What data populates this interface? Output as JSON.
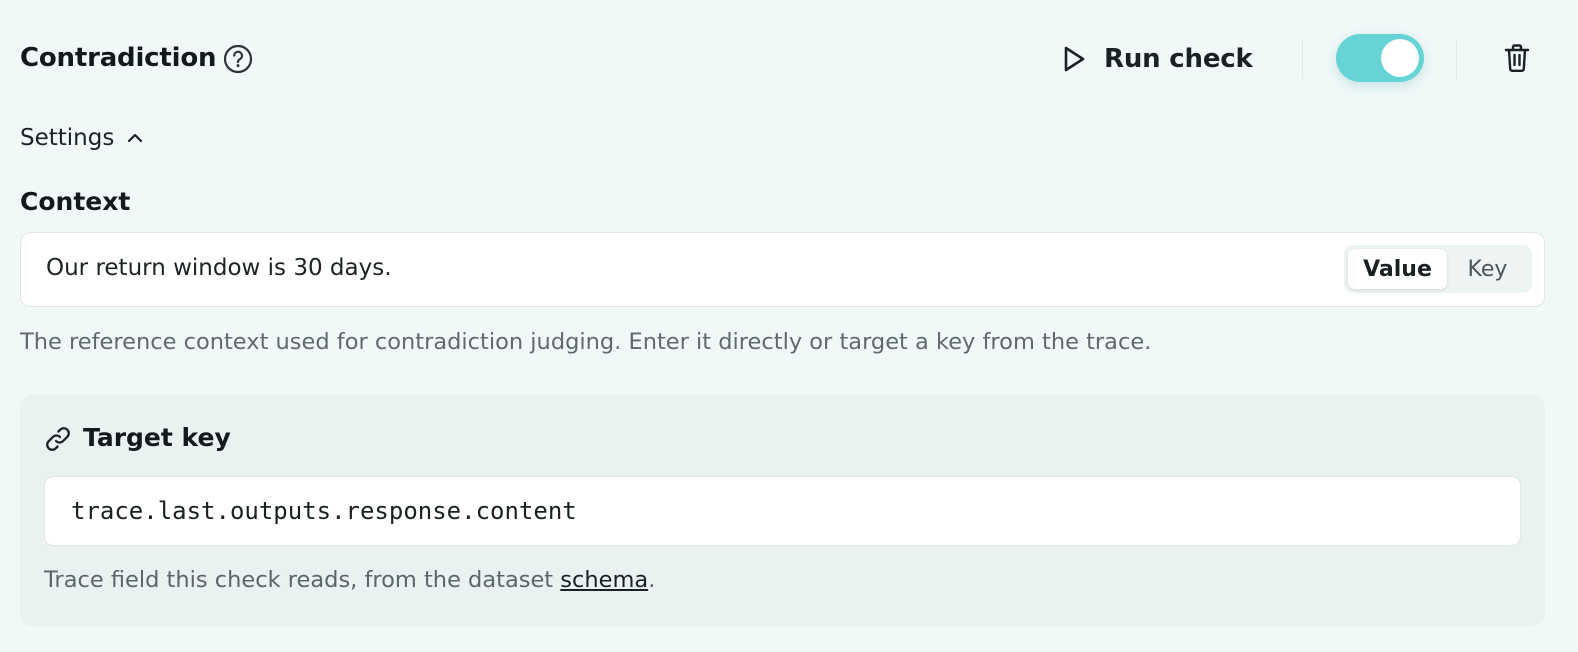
{
  "header": {
    "title": "Contradiction",
    "help_icon": "question-circle-icon",
    "run_label": "Run check",
    "run_icon": "play-icon",
    "toggle": {
      "state": "on",
      "color": "#66d4d6"
    },
    "delete_icon": "trash-icon"
  },
  "settings": {
    "label": "Settings",
    "icon": "chevron-up-icon"
  },
  "context": {
    "label": "Context",
    "value": "Our return window is 30 days.",
    "segments": [
      "Value",
      "Key"
    ],
    "selected_segment": "Value",
    "help": "The reference context used for contradiction judging. Enter it directly or target a key from the trace."
  },
  "target": {
    "icon": "link-icon",
    "title": "Target key",
    "value": "trace.last.outputs.response.content",
    "help_prefix": "Trace field this check reads, from the dataset ",
    "help_link": "schema",
    "help_suffix": "."
  },
  "colors": {
    "background": "#f1f9f8",
    "accent": "#66d4d6",
    "panel": "#e9f1f1"
  }
}
